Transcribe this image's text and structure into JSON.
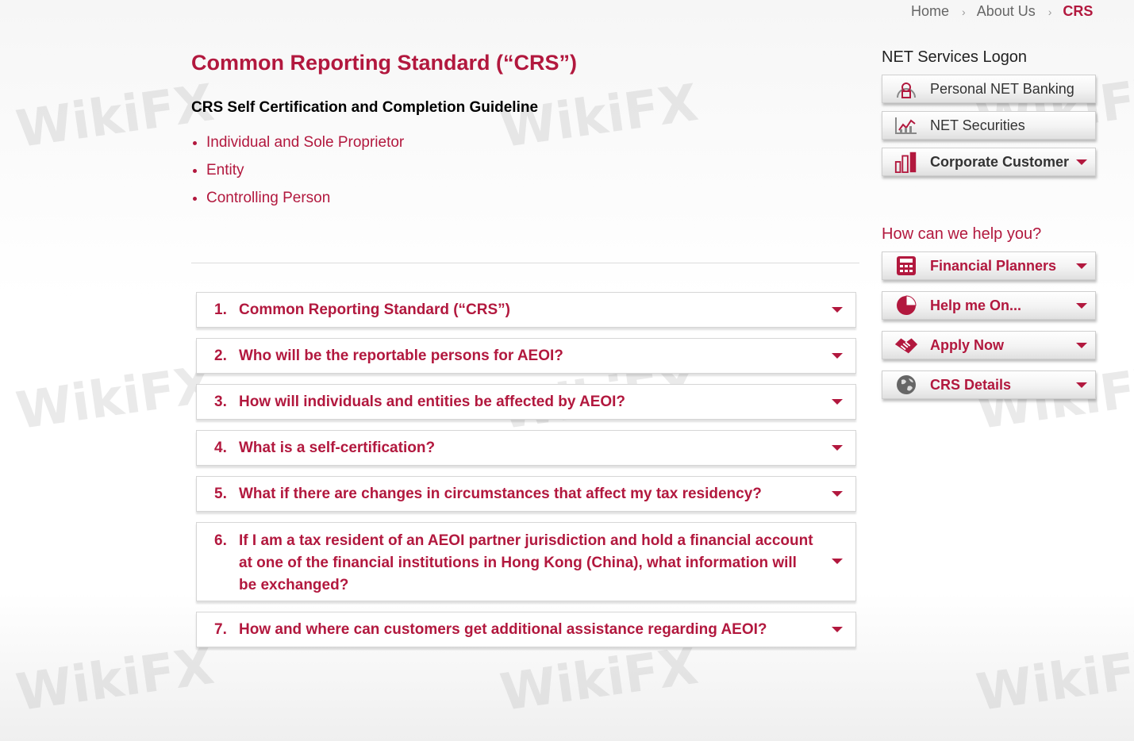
{
  "breadcrumb": {
    "home": "Home",
    "about": "About Us",
    "current": "CRS"
  },
  "main": {
    "title": "Common Reporting Standard (“CRS”)",
    "subtitle": "CRS Self Certification and Completion Guideline",
    "guidelines": [
      "Individual and Sole Proprietor",
      "Entity",
      "Controlling Person"
    ]
  },
  "faq": [
    {
      "num": "1.",
      "question": "Common Reporting Standard (“CRS”)"
    },
    {
      "num": "2.",
      "question": "Who will be the reportable persons for AEOI?"
    },
    {
      "num": "3.",
      "question": "How will individuals and entities be affected by AEOI?"
    },
    {
      "num": "4.",
      "question": "What is a self-certification?"
    },
    {
      "num": "5.",
      "question": "What if there are changes in circumstances that affect my tax residency?"
    },
    {
      "num": "6.",
      "question": "If I am a tax resident of an AEOI partner jurisdiction and hold a financial account at one of the financial institutions in Hong Kong (China), what information will be exchanged?"
    },
    {
      "num": "7.",
      "question": "How and where can customers get additional assistance regarding AEOI?"
    }
  ],
  "sidebar": {
    "logon_heading": "NET Services Logon",
    "logon_buttons": [
      {
        "label": "Personal NET Banking",
        "icon": "lock-person-icon"
      },
      {
        "label": "NET Securities",
        "icon": "chart-icon"
      },
      {
        "label": "Corporate Customer",
        "icon": "building-icon"
      }
    ],
    "help_heading": "How can we help you?",
    "help_buttons": [
      {
        "label": "Financial Planners",
        "icon": "calculator-icon"
      },
      {
        "label": "Help me On...",
        "icon": "pie-chart-icon"
      },
      {
        "label": "Apply Now",
        "icon": "handshake-icon"
      },
      {
        "label": "CRS Details",
        "icon": "globe-icon"
      }
    ]
  },
  "watermark": "WikiFX",
  "colors": {
    "accent": "#b2183e"
  }
}
